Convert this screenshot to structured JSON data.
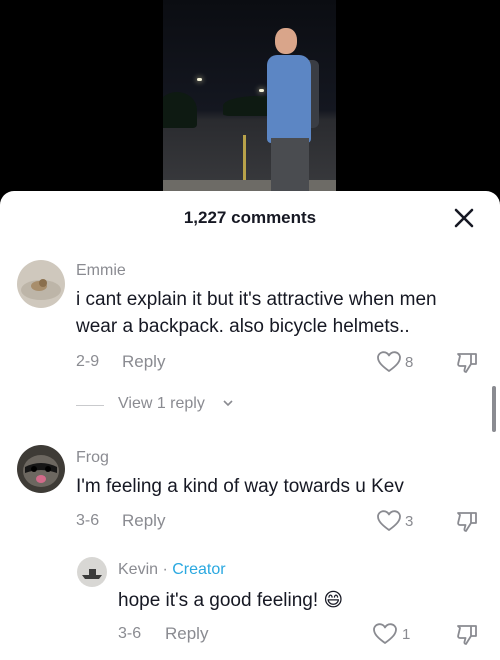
{
  "header": {
    "comment_count": "1,227 comments"
  },
  "comments": [
    {
      "user": "Emmie",
      "text": "i cant explain it but it's attractive when men wear a backpack. also bicycle helmets..",
      "date": "2-9",
      "reply_label": "Reply",
      "likes": "8",
      "view_replies": "View 1 reply"
    },
    {
      "user": "Frog",
      "text": "I'm feeling a kind of way towards u Kev",
      "date": "3-6",
      "reply_label": "Reply",
      "likes": "3"
    }
  ],
  "reply": {
    "user": "Kevin",
    "separator": " · ",
    "badge": "Creator",
    "text": "hope it's a good feeling!",
    "emoji": "😄",
    "date": "3-6",
    "reply_label": "Reply",
    "likes": "1"
  },
  "icons": {
    "close": "close-icon",
    "like": "heart-outline-icon",
    "dislike": "thumbs-down-icon",
    "expand": "chevron-down-icon"
  },
  "colors": {
    "text": "#161823",
    "muted": "#8a8b91",
    "creator": "#2aa8e0"
  }
}
